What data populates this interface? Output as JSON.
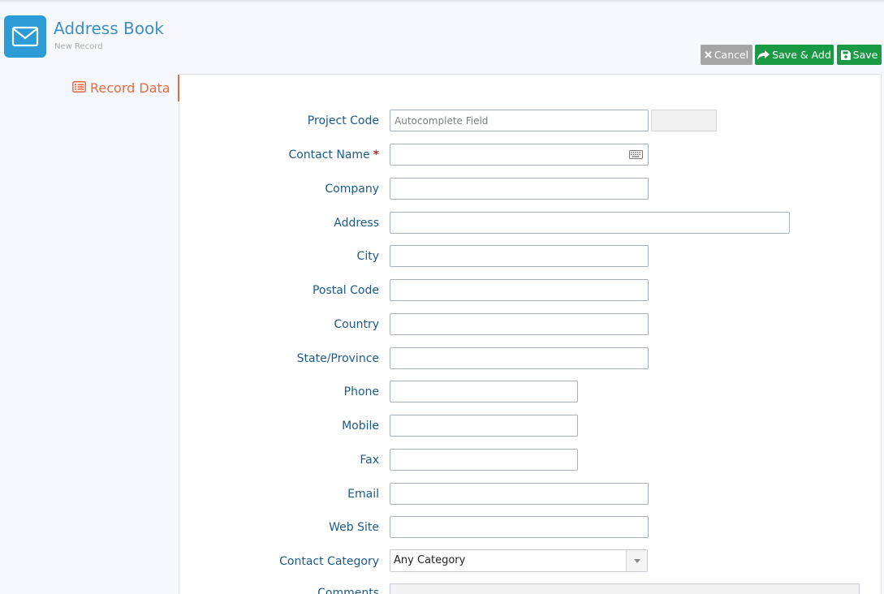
{
  "app": {
    "title": "Address Book",
    "subtitle": "New Record",
    "icon": "envelope-icon",
    "accent": "#2d9bd6"
  },
  "toolbar": {
    "cancel_label": "Cancel",
    "save_add_label": "Save & Add",
    "save_label": "Save"
  },
  "tabs": [
    {
      "label": "Record Data",
      "icon": "list-icon",
      "active": true
    }
  ],
  "form": {
    "project_code": {
      "label": "Project Code",
      "placeholder": "Autocomplete Field",
      "value": ""
    },
    "contact_name": {
      "label": "Contact Name",
      "required_mark": "*",
      "value": ""
    },
    "company": {
      "label": "Company",
      "value": ""
    },
    "address": {
      "label": "Address",
      "value": ""
    },
    "city": {
      "label": "City",
      "value": ""
    },
    "postal_code": {
      "label": "Postal Code",
      "value": ""
    },
    "country": {
      "label": "Country",
      "value": ""
    },
    "state": {
      "label": "State/Province",
      "value": ""
    },
    "phone": {
      "label": "Phone",
      "value": ""
    },
    "mobile": {
      "label": "Mobile",
      "value": ""
    },
    "fax": {
      "label": "Fax",
      "value": ""
    },
    "email": {
      "label": "Email",
      "value": ""
    },
    "website": {
      "label": "Web Site",
      "value": ""
    },
    "contact_category": {
      "label": "Contact Category",
      "selected": "Any Category"
    },
    "comments": {
      "label": "Comments"
    }
  },
  "colors": {
    "cancel": "#a5a5a5",
    "save": "#1a9a44",
    "tab_active": "#ea6a3f",
    "label": "#1b5a8a",
    "required": "#c0282d"
  }
}
